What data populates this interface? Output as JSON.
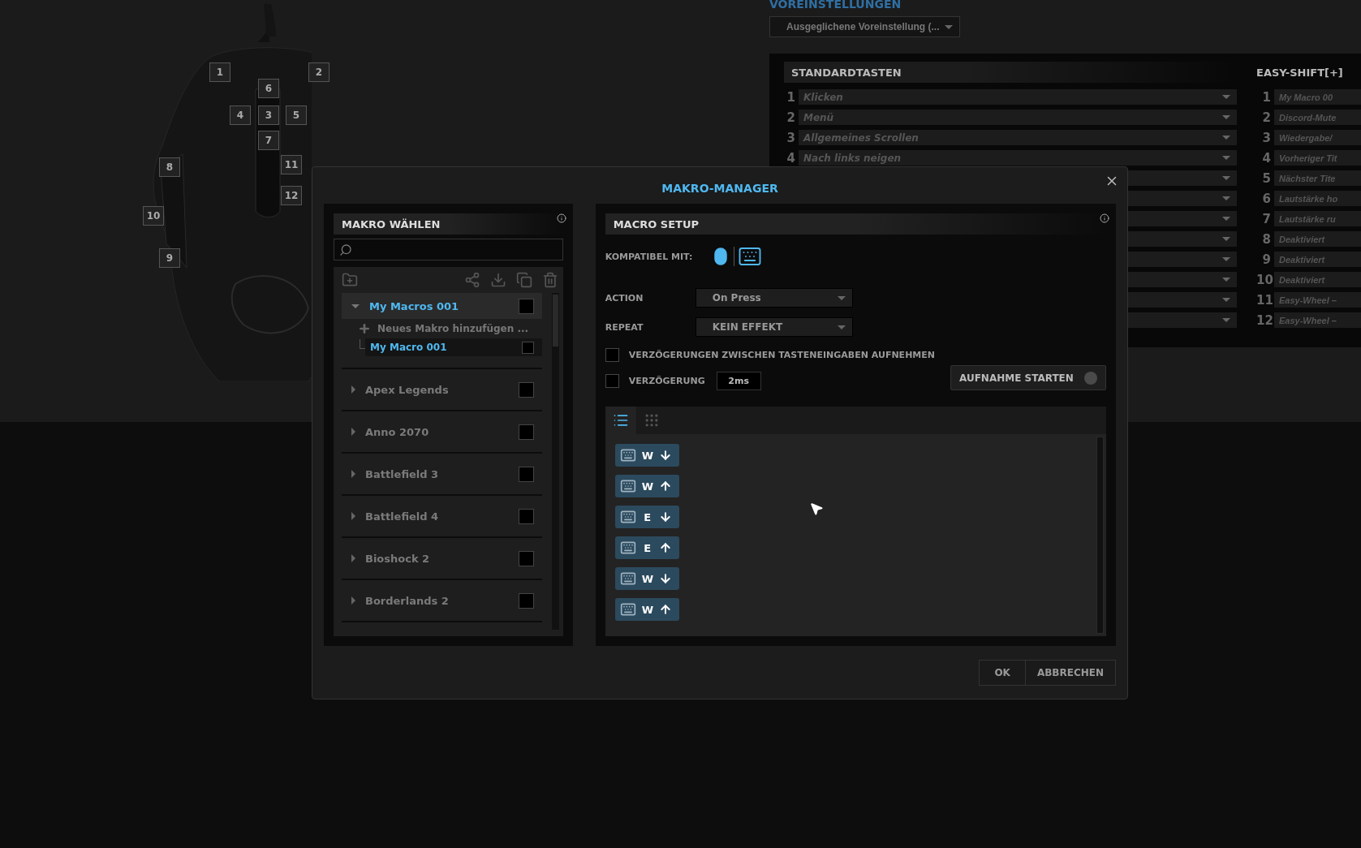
{
  "mouse_buttons": [
    "1",
    "2",
    "6",
    "4",
    "3",
    "5",
    "7",
    "11",
    "8",
    "12",
    "10",
    "9"
  ],
  "presets": {
    "title": "VOREINSTELLUNGEN",
    "value": "Ausgeglichene Voreinstellung (..."
  },
  "standard_keys": {
    "title": "STANDARDTASTEN",
    "rows": [
      {
        "kind": "text",
        "number": "1",
        "label": "Klicken"
      },
      {
        "kind": "text",
        "number": "2",
        "label": "Menü"
      },
      {
        "kind": "text",
        "number": "3",
        "label": "Allgemeines Scrollen"
      },
      {
        "kind": "text",
        "number": "4",
        "label": "Nach links neigen"
      },
      {
        "kind": "covered"
      },
      {
        "kind": "covered"
      },
      {
        "kind": "covered"
      },
      {
        "kind": "covered"
      },
      {
        "kind": "covered"
      },
      {
        "kind": "covered"
      },
      {
        "kind": "covered"
      },
      {
        "kind": "covered"
      }
    ]
  },
  "easy_shift": {
    "title": "EASY-SHIFT[+]",
    "rows": [
      {
        "number": "1",
        "label": "My Macro 00"
      },
      {
        "number": "2",
        "label": "Discord-Mute"
      },
      {
        "number": "3",
        "label": "Wiedergabe/"
      },
      {
        "number": "4",
        "label": "Vorheriger Tit"
      },
      {
        "number": "5",
        "label": "Nächster Tite"
      },
      {
        "number": "6",
        "label": "Lautstärke ho"
      },
      {
        "number": "7",
        "label": "Lautstärke ru"
      },
      {
        "number": "8",
        "label": "Deaktiviert"
      },
      {
        "number": "9",
        "label": "Deaktiviert"
      },
      {
        "number": "10",
        "label": "Deaktiviert"
      },
      {
        "number": "11",
        "label": "Easy-Wheel –"
      },
      {
        "number": "12",
        "label": "Easy-Wheel –"
      }
    ]
  },
  "dialog": {
    "title": "MAKRO-MANAGER",
    "macro_list": {
      "title": "MAKRO WÄHLEN",
      "groups": [
        {
          "name": "My Macros 001",
          "expanded": true,
          "selected": true,
          "checked": false,
          "add_label": "Neues Makro hinzufügen ...",
          "children": [
            {
              "name": "My Macro 001",
              "selected": true,
              "checked": false
            }
          ]
        },
        {
          "name": "Apex Legends",
          "expanded": false,
          "selected": false,
          "checked": false
        },
        {
          "name": "Anno 2070",
          "expanded": false,
          "selected": false,
          "checked": false
        },
        {
          "name": "Battlefield 3",
          "expanded": false,
          "selected": false,
          "checked": false
        },
        {
          "name": "Battlefield 4",
          "expanded": false,
          "selected": false,
          "checked": false
        },
        {
          "name": "Bioshock 2",
          "expanded": false,
          "selected": false,
          "checked": false
        },
        {
          "name": "Borderlands 2",
          "expanded": false,
          "selected": false,
          "checked": false
        }
      ]
    },
    "setup": {
      "title": "MACRO SETUP",
      "compatible": {
        "label": "KOMPATIBEL MIT:",
        "mouse": true,
        "keyboard": true
      },
      "action": {
        "label": "ACTION",
        "value": "On Press"
      },
      "repeat": {
        "label": "REPEAT",
        "value": "KEIN EFFEKT"
      },
      "record_delays": {
        "label": "VERZÖGERUNGEN ZWISCHEN TASTENEINGABEN AUFNEHMEN",
        "checked": false
      },
      "delay": {
        "label": "VERZÖGERUNG",
        "checked": false,
        "value": "2ms"
      },
      "record_button": {
        "label": "AUFNAHME STARTEN",
        "recording": false
      },
      "views": [
        {
          "kind": "list",
          "selected": true
        },
        {
          "kind": "grid",
          "selected": false
        }
      ],
      "events": [
        {
          "key": "W",
          "kind": "down"
        },
        {
          "key": "W",
          "kind": "up"
        },
        {
          "key": "E",
          "kind": "down"
        },
        {
          "key": "E",
          "kind": "up"
        },
        {
          "key": "W",
          "kind": "down"
        },
        {
          "key": "W",
          "kind": "up"
        }
      ]
    },
    "buttons": [
      "OK",
      "ABBRECHEN"
    ]
  }
}
